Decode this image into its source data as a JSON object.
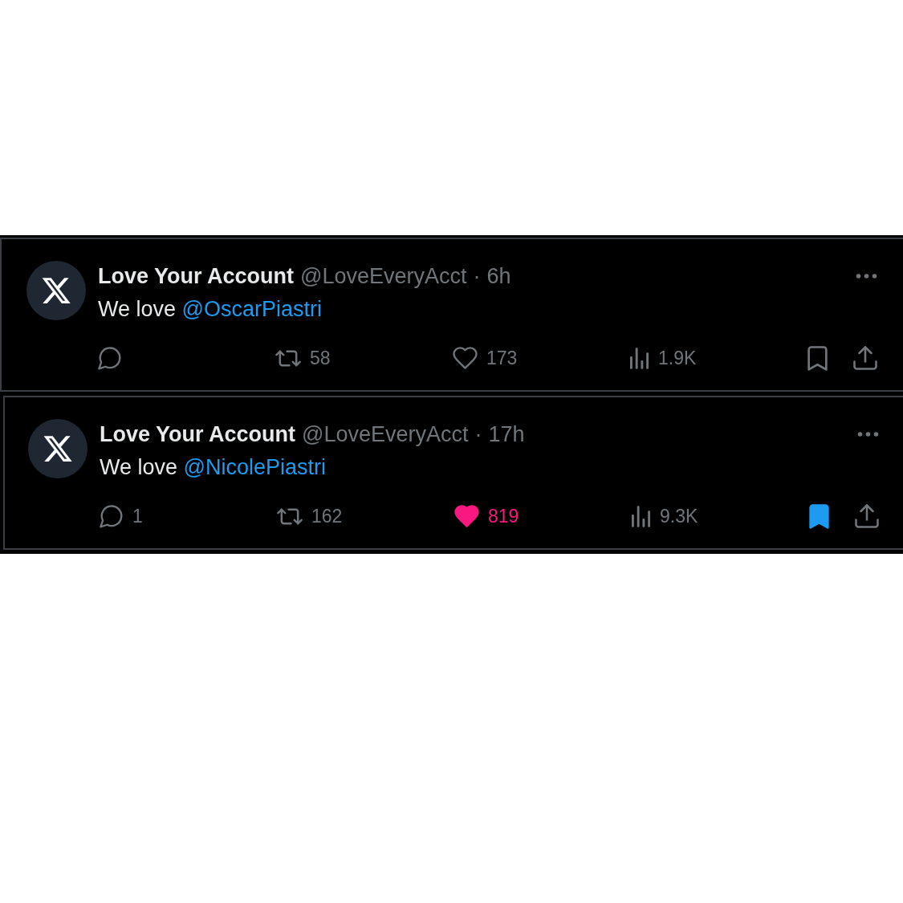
{
  "tweets": [
    {
      "author": "Love Your Account",
      "handle": "@LoveEveryAcct",
      "separator": "·",
      "time": "6h",
      "text": "We love",
      "mention": "@OscarPiastri",
      "actions": [
        {
          "kind": "reply"
        },
        {
          "kind": "retweet",
          "count": "58"
        },
        {
          "kind": "like",
          "count": "173",
          "on": false
        },
        {
          "kind": "views",
          "count": "1.9K"
        },
        {
          "kind": "bookmark",
          "on": false
        },
        {
          "kind": "share"
        }
      ]
    },
    {
      "author": "Love Your Account",
      "handle": "@LoveEveryAcct",
      "separator": "·",
      "time": "17h",
      "text": "We love",
      "mention": "@NicolePiastri",
      "actions": [
        {
          "kind": "reply",
          "count": "1"
        },
        {
          "kind": "retweet",
          "count": "162"
        },
        {
          "kind": "like",
          "count": "819",
          "on": true
        },
        {
          "kind": "views",
          "count": "9.3K"
        },
        {
          "kind": "bookmark",
          "on": true
        },
        {
          "kind": "share"
        }
      ]
    }
  ]
}
